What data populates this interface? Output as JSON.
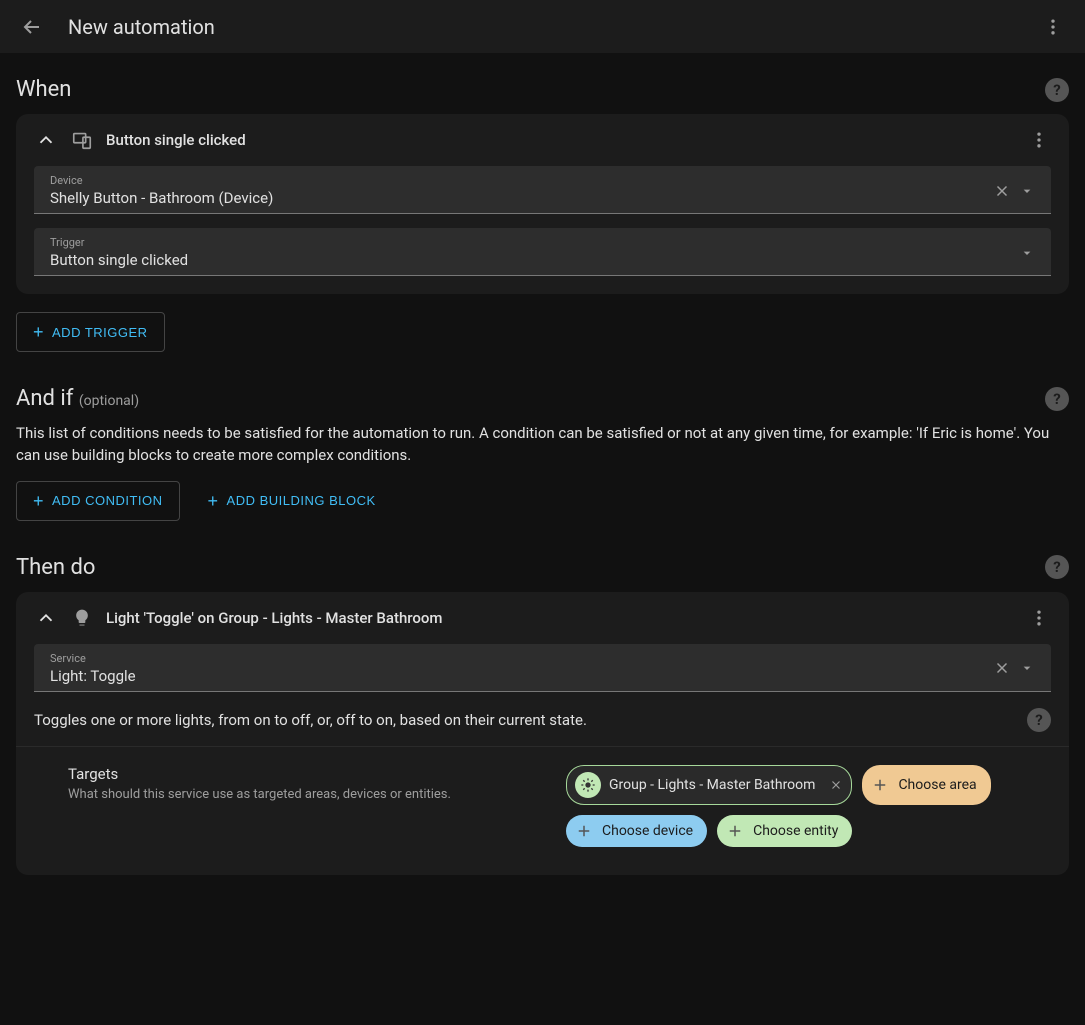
{
  "header": {
    "title": "New automation"
  },
  "sections": {
    "when": {
      "title": "When"
    },
    "andif": {
      "title": "And if",
      "optional": "(optional)"
    },
    "thendo": {
      "title": "Then do"
    }
  },
  "trigger_card": {
    "title": "Button single clicked",
    "device": {
      "label": "Device",
      "value": "Shelly Button - Bathroom (Device)"
    },
    "trigger": {
      "label": "Trigger",
      "value": "Button single clicked"
    }
  },
  "buttons": {
    "add_trigger": "ADD TRIGGER",
    "add_condition": "ADD CONDITION",
    "add_building_block": "ADD BUILDING BLOCK"
  },
  "condition_desc": "This list of conditions needs to be satisfied for the automation to run. A condition can be satisfied or not at any given time, for example: 'If Eric is home'. You can use building blocks to create more complex conditions.",
  "action_card": {
    "title": "Light 'Toggle' on Group - Lights - Master Bathroom",
    "service": {
      "label": "Service",
      "value": "Light: Toggle"
    },
    "service_desc": "Toggles one or more lights, from on to off, or, off to on, based on their current state.",
    "targets": {
      "title": "Targets",
      "sub": "What should this service use as targeted areas, devices or entities.",
      "selected_entity": "Group - Lights - Master Bathroom",
      "choose_area": "Choose area",
      "choose_device": "Choose device",
      "choose_entity": "Choose entity"
    }
  }
}
